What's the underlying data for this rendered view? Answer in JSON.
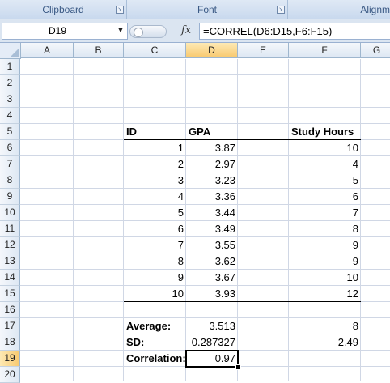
{
  "ribbon": {
    "groups": [
      {
        "label": "Clipboard"
      },
      {
        "label": "Font"
      },
      {
        "label": "Alignm"
      }
    ]
  },
  "formula_bar": {
    "name_box": "D19",
    "fx_label": "fx",
    "formula": "=CORREL(D6:D15,F6:F15)"
  },
  "columns": [
    "A",
    "B",
    "C",
    "D",
    "E",
    "F",
    "G"
  ],
  "selected_column": "D",
  "rows": [
    "1",
    "2",
    "3",
    "4",
    "5",
    "6",
    "7",
    "8",
    "9",
    "10",
    "11",
    "12",
    "13",
    "14",
    "15",
    "16",
    "17",
    "18",
    "19",
    "20"
  ],
  "selected_row": "19",
  "table": {
    "headers": {
      "id": "ID",
      "gpa": "GPA",
      "study": "Study Hours"
    },
    "data": [
      {
        "id": "1",
        "gpa": "3.87",
        "study": "10"
      },
      {
        "id": "2",
        "gpa": "2.97",
        "study": "4"
      },
      {
        "id": "3",
        "gpa": "3.23",
        "study": "5"
      },
      {
        "id": "4",
        "gpa": "3.36",
        "study": "6"
      },
      {
        "id": "5",
        "gpa": "3.44",
        "study": "7"
      },
      {
        "id": "6",
        "gpa": "3.49",
        "study": "8"
      },
      {
        "id": "7",
        "gpa": "3.55",
        "study": "9"
      },
      {
        "id": "8",
        "gpa": "3.62",
        "study": "9"
      },
      {
        "id": "9",
        "gpa": "3.67",
        "study": "10"
      },
      {
        "id": "10",
        "gpa": "3.93",
        "study": "12"
      }
    ]
  },
  "summary": {
    "average_label": "Average:",
    "average_gpa": "3.513",
    "average_study": "8",
    "sd_label": "SD:",
    "sd_gpa": "0.287327",
    "sd_study": "2.49",
    "corr_label": "Correlation:",
    "corr_value": "0.97"
  }
}
